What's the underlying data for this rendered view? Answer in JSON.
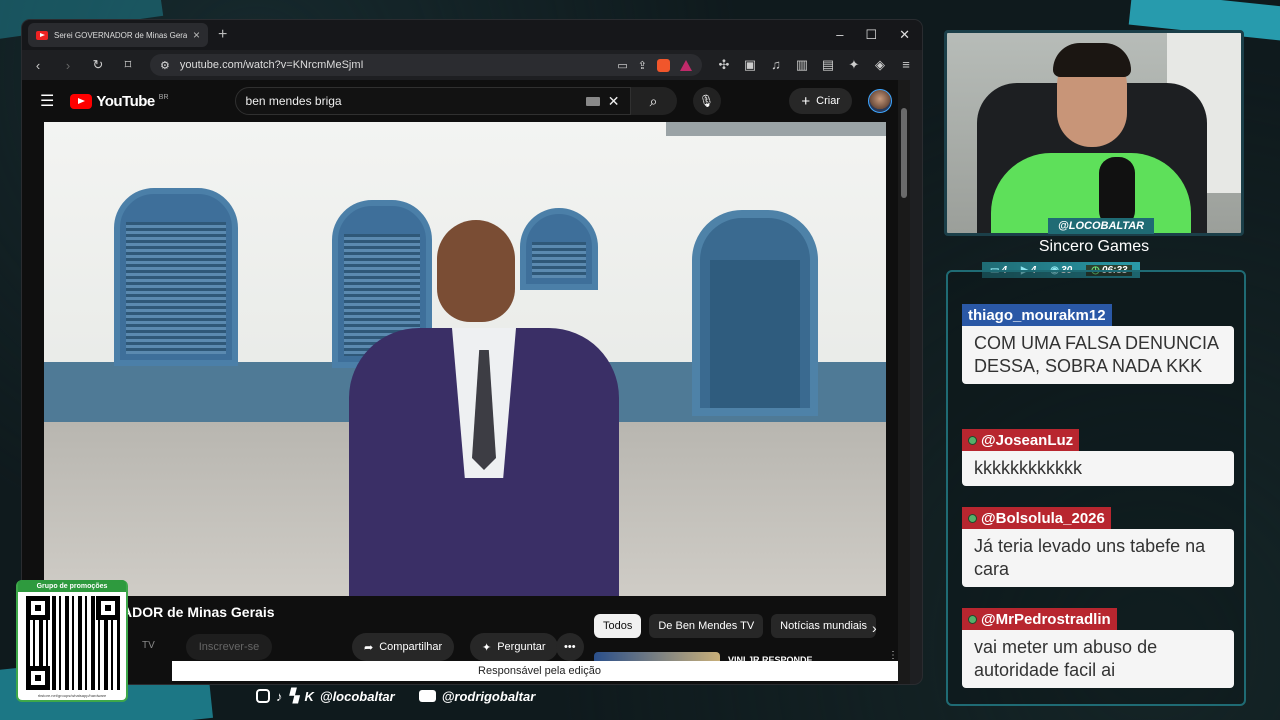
{
  "browser": {
    "tab_title": "Serei GOVERNADOR de Minas Gerais",
    "url": "youtube.com/watch?v=KNrcmMeSjmI",
    "window_controls": [
      "–",
      "☐",
      "✕"
    ]
  },
  "youtube": {
    "logo": "YouTube",
    "country": "BR",
    "search_query": "ben mendes briga",
    "create_label": "Criar",
    "video_title_partial": "ADOR de Minas Gerais",
    "channel_partial": "TV",
    "subscribe_label": "Inscrever-se",
    "share_label": "Compartilhar",
    "ask_label": "Perguntar",
    "chips": [
      "Todos",
      "De Ben Mendes TV",
      "Notícias mundiais"
    ],
    "next_video_title": "VINI JR RESPONDE",
    "tooltip": "Responsável pela edição"
  },
  "stream": {
    "cam_tag": "@LOCOBALTAR",
    "channel_name": "Sincero Games",
    "stats": [
      "4",
      "4",
      "30",
      "06:33"
    ],
    "qr_header": "Grupo de promoções",
    "qr_footer": "rbstore.net/groups/whatsapp/hardware",
    "social_handle_1": "@locobaltar",
    "social_handle_2": "@rodrigobaltar"
  },
  "chat": [
    {
      "user": "thiago_mourakm12",
      "text": "COM UMA FALSA DENUNCIA DESSA, SOBRA NADA KKK"
    },
    {
      "user": "@JoseanLuz",
      "text": "kkkkkkkkkkkk"
    },
    {
      "user": "@Bolsolula_2026",
      "text": "Já teria levado uns tabefe na cara"
    },
    {
      "user": "@MrPedrostradlin",
      "text": "vai meter um abuso de autoridade facil ai"
    }
  ]
}
